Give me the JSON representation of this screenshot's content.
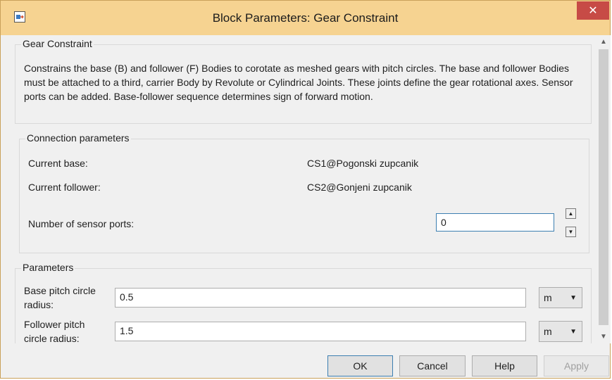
{
  "window": {
    "title": "Block Parameters: Gear Constraint",
    "close_glyph": "✕"
  },
  "block": {
    "name": "Gear Constraint",
    "description": "Constrains the base (B) and follower (F) Bodies to corotate as meshed gears with pitch circles. The base and follower Bodies must be attached to a third, carrier Body by Revolute or Cylindrical Joints. These joints define the gear rotational axes. Sensor ports can be added. Base-follower sequence determines sign of forward motion."
  },
  "connection": {
    "group_label": "Connection parameters",
    "current_base_label": "Current base:",
    "current_base_value": "CS1@Pogonski zupcanik",
    "current_follower_label": "Current follower:",
    "current_follower_value": "CS2@Gonjeni zupcanik",
    "sensor_ports_label": "Number of sensor ports:",
    "sensor_ports_value": "0"
  },
  "parameters": {
    "group_label": "Parameters",
    "base_radius_label_line1": "Base pitch circle",
    "base_radius_label_line2": "radius:",
    "base_radius_value": "0.5",
    "base_radius_unit": "m",
    "follower_radius_label_line1": "Follower pitch",
    "follower_radius_label_line2": "circle radius:",
    "follower_radius_value": "1.5",
    "follower_radius_unit": "m"
  },
  "buttons": {
    "ok": "OK",
    "cancel": "Cancel",
    "help": "Help",
    "apply": "Apply"
  },
  "icons": {
    "app": "simulink-block-icon",
    "close": "close-icon",
    "spin_up": "spin-up-icon",
    "spin_down": "spin-down-icon",
    "dropdown": "chevron-down-icon",
    "scroll_up": "scroll-up-icon",
    "scroll_down": "scroll-down-icon"
  },
  "colors": {
    "titlebar": "#f6d391",
    "close_button": "#c74b46",
    "focus_border": "#3c7fb1"
  }
}
